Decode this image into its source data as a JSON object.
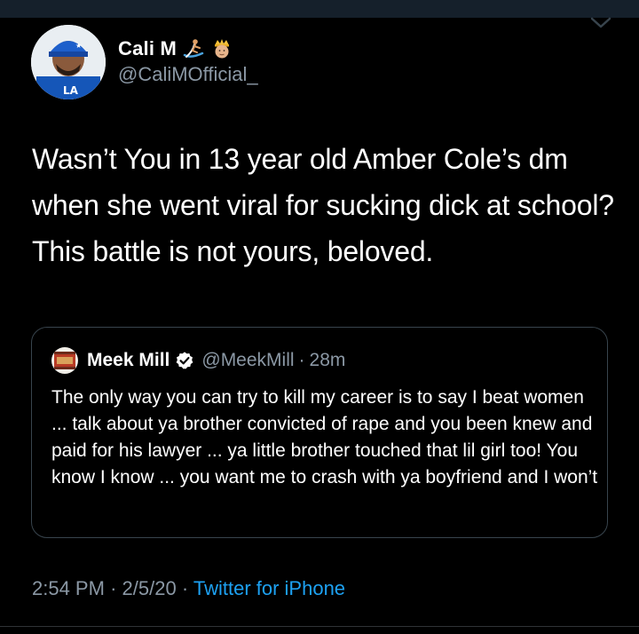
{
  "tweet": {
    "display_name": "Cali M",
    "handle": "@CaliMOfficial_",
    "text": "Wasn’t You in 13 year old Amber Cole’s dm when she went viral for sucking dick at school? This battle is not yours, beloved.",
    "timestamp_time": "2:54 PM",
    "timestamp_date": "2/5/20",
    "separator": "·",
    "source": "Twitter for iPhone",
    "emojis": [
      "surfer-emoji",
      "crown-prince-emoji"
    ]
  },
  "quote": {
    "display_name": "Meek Mill",
    "handle": "@MeekMill",
    "separator": "·",
    "age": "28m",
    "verified": true,
    "text": "The only way you can try to kill my career is to say I beat women ... talk about ya brother convicted of rape and you been knew and paid for his lawyer ... ya little brother touched that lil girl too! You know I know ... you want me to crash with ya boyfriend and I won’t"
  },
  "icons": {
    "chevron": "chevron-down-icon",
    "verified": "verified-badge-icon"
  },
  "colors": {
    "background": "#000000",
    "text": "#ffffff",
    "secondary_text": "#8b98a5",
    "link": "#1da1f2",
    "border": "#38444d",
    "top_bar": "#15202b"
  }
}
